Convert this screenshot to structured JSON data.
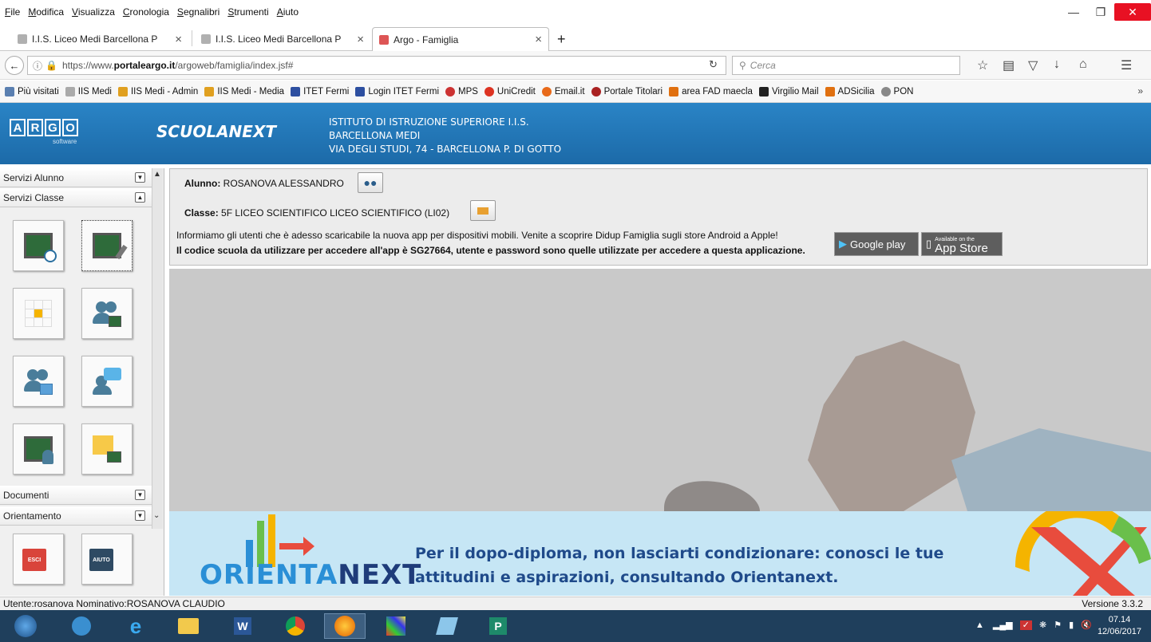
{
  "browser": {
    "menu": [
      "File",
      "Modifica",
      "Visualizza",
      "Cronologia",
      "Segnalibri",
      "Strumenti",
      "Aiuto"
    ],
    "tabs": [
      {
        "title": "I.I.S. Liceo Medi Barcellona P",
        "active": false
      },
      {
        "title": "I.I.S. Liceo Medi Barcellona P",
        "active": false
      },
      {
        "title": "Argo - Famiglia",
        "active": true
      }
    ],
    "new_tab": "+",
    "close_tab": "×",
    "url_prefix": "https://www.",
    "url_domain": "portaleargo.it",
    "url_path": "/argoweb/famiglia/index.jsf#",
    "search_placeholder": "Cerca",
    "bookmarks": [
      "Più visitati",
      "IIS Medi",
      "IIS Medi - Admin",
      "IIS Medi - Media",
      "ITET Fermi",
      "Login ITET Fermi",
      "MPS",
      "UniCredit",
      "Email.it",
      "Portale Titolari",
      "area FAD maecla",
      "Virgilio Mail",
      "ADSicilia",
      "PON"
    ],
    "bookmarks_more": "»"
  },
  "header": {
    "logo_letters": [
      "A",
      "R",
      "G",
      "O"
    ],
    "logo_sub": "software",
    "product": "SCUOLANEXT",
    "school_line1": "ISTITUTO DI ISTRUZIONE SUPERIORE I.I.S.",
    "school_line2": "BARCELLONA MEDI",
    "school_line3": "VIA DEGLI STUDI, 74 - BARCELLONA P. DI GOTTO"
  },
  "sidebar": {
    "sections": [
      "Servizi Alunno",
      "Servizi Classe",
      "Documenti",
      "Orientamento"
    ],
    "exit_label": "ESCI",
    "help_label": "AIUTO"
  },
  "info": {
    "student_label": "Alunno:",
    "student_name": "ROSANOVA ALESSANDRO",
    "class_label": "Classe:",
    "class_name": "5F LICEO SCIENTIFICO LICEO SCIENTIFICO (LI02)",
    "message1": "Informiamo gli utenti che è adesso scaricabile la nuova app per dispositivi mobili. Venite a scoprire Didup Famiglia sugli store Android a Apple!",
    "message2": "Il codice scuola da utilizzare per accedere all'app è SG27664, utente e password sono quelle utilizzate per accedere a questa applicazione.",
    "google_play": "Google play",
    "app_store_small": "Available on the",
    "app_store": "App Store"
  },
  "banner": {
    "logo_a": "ORIENTA",
    "logo_b": "NEXT",
    "line1": "Per il dopo-diploma, non lasciarti condizionare: conosci le tue",
    "line2": "attitudini e aspirazioni, consultando Orientanext."
  },
  "status": {
    "user_text": "Utente:rosanova Nominativo:ROSANOVA CLAUDIO",
    "version": "Versione 3.3.2"
  },
  "taskbar": {
    "time": "07.14",
    "date": "12/06/2017"
  },
  "colors": {
    "header": "#1c6aa8",
    "accent": "#2a84c6",
    "close": "#e81123"
  }
}
